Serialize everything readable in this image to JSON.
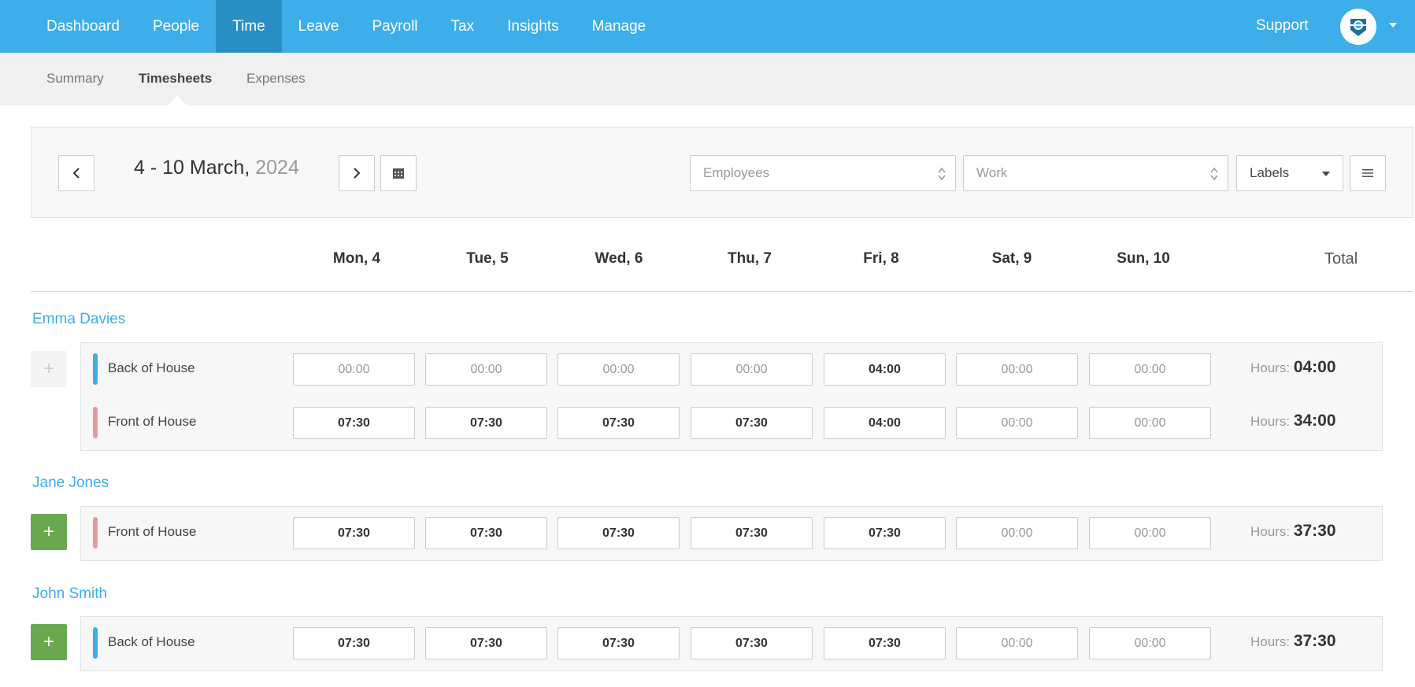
{
  "topnav": {
    "items": [
      {
        "label": "Dashboard",
        "active": false
      },
      {
        "label": "People",
        "active": false
      },
      {
        "label": "Time",
        "active": true
      },
      {
        "label": "Leave",
        "active": false
      },
      {
        "label": "Payroll",
        "active": false
      },
      {
        "label": "Tax",
        "active": false
      },
      {
        "label": "Insights",
        "active": false
      },
      {
        "label": "Manage",
        "active": false
      }
    ],
    "support": "Support"
  },
  "subnav": {
    "items": [
      {
        "label": "Summary",
        "active": false
      },
      {
        "label": "Timesheets",
        "active": true
      },
      {
        "label": "Expenses",
        "active": false
      }
    ]
  },
  "toolbar": {
    "date_range": "4 - 10 March,",
    "year": " 2024",
    "employees_placeholder": "Employees",
    "work_placeholder": "Work",
    "labels": "Labels"
  },
  "days": [
    "Mon, 4",
    "Tue, 5",
    "Wed, 6",
    "Thu, 7",
    "Fri, 8",
    "Sat, 9",
    "Sun, 10"
  ],
  "total_label": "Total",
  "hours_label": "Hours:",
  "colors": {
    "accent": "#3daee9",
    "back_of_house": "#3daee9",
    "front_of_house": "#e79a9a",
    "add_green": "#6aa84f"
  },
  "employees": [
    {
      "name": "Emma Davies",
      "rows": [
        {
          "work": "Back of House",
          "color": "#3daee9",
          "values": [
            "00:00",
            "00:00",
            "00:00",
            "00:00",
            "04:00",
            "00:00",
            "00:00"
          ],
          "hours": "04:00"
        },
        {
          "work": "Front of House",
          "color": "#e79a9a",
          "values": [
            "07:30",
            "07:30",
            "07:30",
            "07:30",
            "04:00",
            "00:00",
            "00:00"
          ],
          "hours": "34:00"
        }
      ]
    },
    {
      "name": "Jane Jones",
      "rows": [
        {
          "work": "Front of House",
          "color": "#e79a9a",
          "values": [
            "07:30",
            "07:30",
            "07:30",
            "07:30",
            "07:30",
            "00:00",
            "00:00"
          ],
          "hours": "37:30"
        }
      ]
    },
    {
      "name": "John Smith",
      "rows": [
        {
          "work": "Back of House",
          "color": "#3daee9",
          "values": [
            "07:30",
            "07:30",
            "07:30",
            "07:30",
            "07:30",
            "00:00",
            "00:00"
          ],
          "hours": "37:30"
        }
      ]
    }
  ]
}
